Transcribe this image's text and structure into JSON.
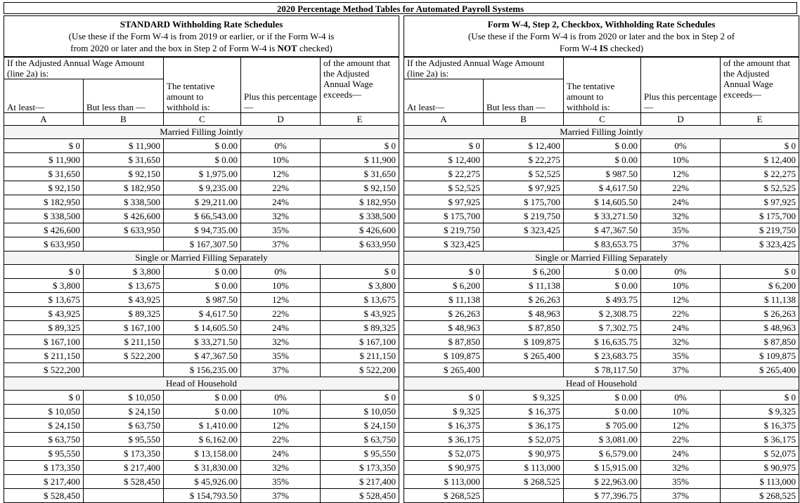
{
  "title": "2020 Percentage Method Tables for Automated Payroll Systems",
  "schedules": [
    {
      "key": "standard",
      "caption_title": "STANDARD Withholding Rate Schedules",
      "caption_line1": "(Use these if the Form W-4 is from 2019 or earlier, or if the Form W-4 is",
      "caption_line2_pre": "from 2020 or later and the box in Step 2 of Form W-4 is ",
      "caption_line2_bold": "NOT",
      "caption_line2_post": " checked)",
      "headers": {
        "group_ab": "If the Adjusted Annual Wage Amount (line 2a) is:",
        "at_least": "At least—",
        "but_less_than": "But less than —",
        "tentative": "The tentative amount to withhold is:",
        "plus_pct": "Plus this percentage—",
        "exceeds": "of the amount that the Adjusted Annual Wage exceeds—",
        "letters": [
          "A",
          "B",
          "C",
          "D",
          "E"
        ]
      },
      "sections": [
        {
          "name": "Married Filling Jointly",
          "rows": [
            [
              "$ 0",
              "$ 11,900",
              "$ 0.00",
              "0%",
              "$ 0"
            ],
            [
              "$ 11,900",
              "$ 31,650",
              "$ 0.00",
              "10%",
              "$ 11,900"
            ],
            [
              "$ 31,650",
              "$ 92,150",
              "$ 1,975.00",
              "12%",
              "$ 31,650"
            ],
            [
              "$ 92,150",
              "$ 182,950",
              "$ 9,235.00",
              "22%",
              "$ 92,150"
            ],
            [
              "$ 182,950",
              "$ 338,500",
              "$ 29,211.00",
              "24%",
              "$ 182,950"
            ],
            [
              "$ 338,500",
              "$ 426,600",
              "$ 66,543.00",
              "32%",
              "$ 338,500"
            ],
            [
              "$ 426,600",
              "$ 633,950",
              "$ 94,735.00",
              "35%",
              "$ 426,600"
            ],
            [
              "$ 633,950",
              "",
              "$ 167,307.50",
              "37%",
              "$ 633,950"
            ]
          ]
        },
        {
          "name": "Single or Married Filling Separately",
          "rows": [
            [
              "$ 0",
              "$ 3,800",
              "$ 0.00",
              "0%",
              "$ 0"
            ],
            [
              "$ 3,800",
              "$ 13,675",
              "$ 0.00",
              "10%",
              "$ 3,800"
            ],
            [
              "$ 13,675",
              "$ 43,925",
              "$ 987.50",
              "12%",
              "$ 13,675"
            ],
            [
              "$ 43,925",
              "$ 89,325",
              "$ 4,617.50",
              "22%",
              "$ 43,925"
            ],
            [
              "$ 89,325",
              "$ 167,100",
              "$ 14,605.50",
              "24%",
              "$ 89,325"
            ],
            [
              "$ 167,100",
              "$ 211,150",
              "$ 33,271.50",
              "32%",
              "$ 167,100"
            ],
            [
              "$ 211,150",
              "$ 522,200",
              "$ 47,367.50",
              "35%",
              "$ 211,150"
            ],
            [
              "$ 522,200",
              "",
              "$ 156,235.00",
              "37%",
              "$ 522,200"
            ]
          ]
        },
        {
          "name": "Head of Household",
          "rows": [
            [
              "$ 0",
              "$ 10,050",
              "$ 0.00",
              "0%",
              "$ 0"
            ],
            [
              "$ 10,050",
              "$ 24,150",
              "$ 0.00",
              "10%",
              "$ 10,050"
            ],
            [
              "$ 24,150",
              "$ 63,750",
              "$ 1,410.00",
              "12%",
              "$ 24,150"
            ],
            [
              "$ 63,750",
              "$ 95,550",
              "$ 6,162.00",
              "22%",
              "$ 63,750"
            ],
            [
              "$ 95,550",
              "$ 173,350",
              "$ 13,158.00",
              "24%",
              "$ 95,550"
            ],
            [
              "$ 173,350",
              "$ 217,400",
              "$ 31,830.00",
              "32%",
              "$ 173,350"
            ],
            [
              "$ 217,400",
              "$ 528,450",
              "$ 45,926.00",
              "35%",
              "$ 217,400"
            ],
            [
              "$ 528,450",
              "",
              "$ 154,793.50",
              "37%",
              "$ 528,450"
            ]
          ]
        }
      ]
    },
    {
      "key": "checkbox",
      "caption_title": "Form W-4, Step 2, Checkbox, Withholding Rate Schedules",
      "caption_line1": "(Use these if the Form W-4 is from 2020 or later and the box in Step 2 of",
      "caption_line2_pre": "Form W-4 ",
      "caption_line2_bold": "IS",
      "caption_line2_post": " checked)",
      "headers": {
        "group_ab": "If the Adjusted Annual Wage Amount (line 2a) is:",
        "at_least": "At least—",
        "but_less_than": "But less than —",
        "tentative": "The tentative amount to withhold is:",
        "plus_pct": "Plus this percentage—",
        "exceeds": "of the amount that the Adjusted Annual Wage exceeds—",
        "letters": [
          "A",
          "B",
          "C",
          "D",
          "E"
        ]
      },
      "sections": [
        {
          "name": "Married Filling Jointly",
          "rows": [
            [
              "$ 0",
              "$ 12,400",
              "$ 0.00",
              "0%",
              "$ 0"
            ],
            [
              "$ 12,400",
              "$ 22,275",
              "$ 0.00",
              "10%",
              "$ 12,400"
            ],
            [
              "$ 22,275",
              "$ 52,525",
              "$ 987.50",
              "12%",
              "$ 22,275"
            ],
            [
              "$ 52,525",
              "$ 97,925",
              "$ 4,617.50",
              "22%",
              "$ 52,525"
            ],
            [
              "$ 97,925",
              "$ 175,700",
              "$ 14,605.50",
              "24%",
              "$ 97,925"
            ],
            [
              "$ 175,700",
              "$ 219,750",
              "$ 33,271.50",
              "32%",
              "$ 175,700"
            ],
            [
              "$ 219,750",
              "$ 323,425",
              "$ 47,367.50",
              "35%",
              "$ 219,750"
            ],
            [
              "$ 323,425",
              "",
              "$ 83,653.75",
              "37%",
              "$ 323,425"
            ]
          ]
        },
        {
          "name": "Single or Married Filling Separately",
          "rows": [
            [
              "$ 0",
              "$ 6,200",
              "$ 0.00",
              "0%",
              "$ 0"
            ],
            [
              "$ 6,200",
              "$ 11,138",
              "$ 0.00",
              "10%",
              "$ 6,200"
            ],
            [
              "$ 11,138",
              "$ 26,263",
              "$ 493.75",
              "12%",
              "$ 11,138"
            ],
            [
              "$ 26,263",
              "$ 48,963",
              "$ 2,308.75",
              "22%",
              "$ 26,263"
            ],
            [
              "$ 48,963",
              "$ 87,850",
              "$ 7,302.75",
              "24%",
              "$ 48,963"
            ],
            [
              "$ 87,850",
              "$ 109,875",
              "$ 16,635.75",
              "32%",
              "$ 87,850"
            ],
            [
              "$ 109,875",
              "$ 265,400",
              "$ 23,683.75",
              "35%",
              "$ 109,875"
            ],
            [
              "$ 265,400",
              "",
              "$ 78,117.50",
              "37%",
              "$ 265,400"
            ]
          ]
        },
        {
          "name": "Head of Household",
          "rows": [
            [
              "$ 0",
              "$ 9,325",
              "$ 0.00",
              "0%",
              "$ 0"
            ],
            [
              "$ 9,325",
              "$ 16,375",
              "$ 0.00",
              "10%",
              "$ 9,325"
            ],
            [
              "$ 16,375",
              "$ 36,175",
              "$ 705.00",
              "12%",
              "$ 16,375"
            ],
            [
              "$ 36,175",
              "$ 52,075",
              "$ 3,081.00",
              "22%",
              "$ 36,175"
            ],
            [
              "$ 52,075",
              "$ 90,975",
              "$ 6,579.00",
              "24%",
              "$ 52,075"
            ],
            [
              "$ 90,975",
              "$ 113,000",
              "$ 15,915.00",
              "32%",
              "$ 90,975"
            ],
            [
              "$ 113,000",
              "$ 268,525",
              "$ 22,963.00",
              "35%",
              "$ 113,000"
            ],
            [
              "$ 268,525",
              "",
              "$ 77,396.75",
              "37%",
              "$ 268,525"
            ]
          ]
        }
      ]
    }
  ]
}
